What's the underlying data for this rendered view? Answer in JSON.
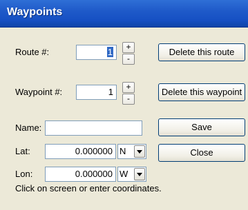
{
  "window": {
    "title": "Waypoints"
  },
  "route": {
    "label": "Route #:",
    "value": "1",
    "increment": "+",
    "decrement": "-",
    "delete_label": "Delete this route"
  },
  "waypoint": {
    "label": "Waypoint #:",
    "value": "1",
    "increment": "+",
    "decrement": "-",
    "delete_label": "Delete this waypoint"
  },
  "name": {
    "label": "Name:",
    "value": "",
    "save_label": "Save"
  },
  "lat": {
    "label": "Lat:",
    "value": "0.000000",
    "hemisphere": "N",
    "close_label": "Close"
  },
  "lon": {
    "label": "Lon:",
    "value": "0.000000",
    "hemisphere": "W"
  },
  "hint": "Click on screen or enter coordinates.",
  "colors": {
    "titlebar": "#1f5ac9",
    "selection": "#316ac5",
    "background": "#ece9d8"
  }
}
